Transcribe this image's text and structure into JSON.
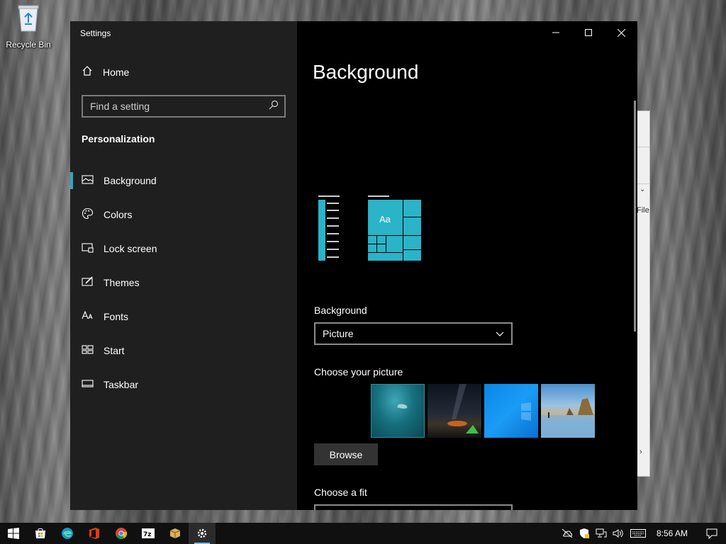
{
  "desktop": {
    "recycle_bin_label": "Recycle Bin"
  },
  "background_window": {
    "partial_text": "File"
  },
  "settings": {
    "window_title": "Settings",
    "sidebar": {
      "home_label": "Home",
      "search_placeholder": "Find a setting",
      "section_title": "Personalization",
      "items": [
        {
          "label": "Background",
          "icon": "picture-icon",
          "active": true
        },
        {
          "label": "Colors",
          "icon": "palette-icon",
          "active": false
        },
        {
          "label": "Lock screen",
          "icon": "lock-screen-icon",
          "active": false
        },
        {
          "label": "Themes",
          "icon": "themes-icon",
          "active": false
        },
        {
          "label": "Fonts",
          "icon": "fonts-icon",
          "active": false
        },
        {
          "label": "Start",
          "icon": "start-icon",
          "active": false
        },
        {
          "label": "Taskbar",
          "icon": "taskbar-icon",
          "active": false
        }
      ]
    },
    "main": {
      "page_title": "Background",
      "preview_sample_text": "Aa",
      "background_label": "Background",
      "background_value": "Picture",
      "choose_picture_label": "Choose your picture",
      "browse_label": "Browse",
      "choose_fit_label": "Choose a fit"
    }
  },
  "taskbar": {
    "icons": [
      "start-icon",
      "store-icon",
      "edge-icon",
      "office-icon",
      "chrome-icon",
      "7zip-icon",
      "package-icon",
      "settings-icon"
    ],
    "clock": "8:56 AM"
  },
  "colors": {
    "accent": "#28a8c8",
    "sidebar_bg": "#1f1f1f",
    "main_bg": "#000000",
    "taskbar_bg": "#101010"
  }
}
